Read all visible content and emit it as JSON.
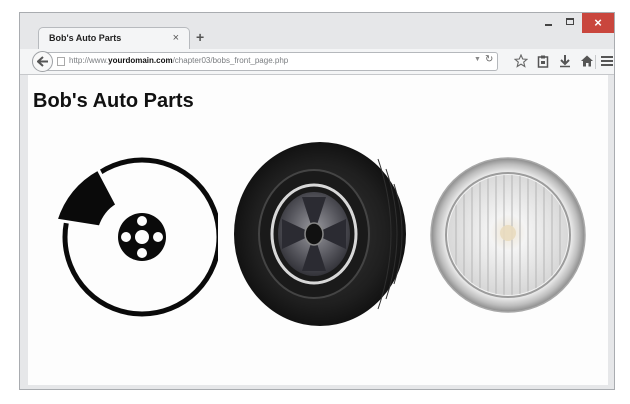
{
  "browser": {
    "tab": {
      "title": "Bob's Auto Parts",
      "close_glyph": "×"
    },
    "new_tab_glyph": "+",
    "window_controls": {
      "close_glyph": "×"
    },
    "address": {
      "prefix": "http://www.",
      "domain": "yourdomain.com",
      "path": "/chapter03/bobs_front_page.php"
    },
    "toolbar_icons": [
      "back-arrow-icon",
      "star-icon",
      "clipboard-icon",
      "download-icon",
      "home-icon",
      "menu-icon"
    ]
  },
  "page": {
    "title": "Bob's Auto Parts",
    "images": [
      "brake-disc-icon",
      "tyre-image",
      "headlamp-image"
    ]
  }
}
